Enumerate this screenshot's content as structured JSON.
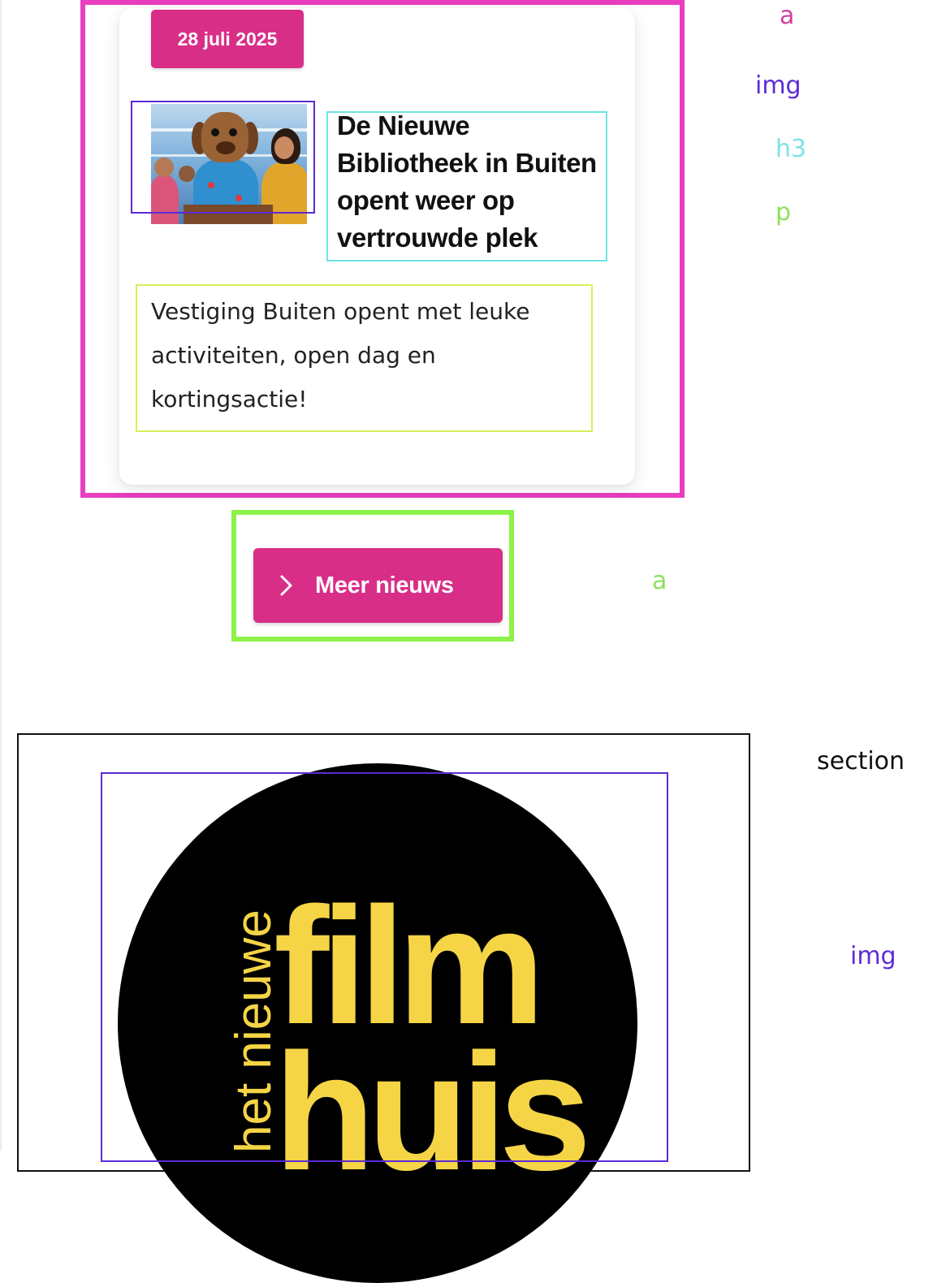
{
  "news_card": {
    "date": "28 juli 2025",
    "title": "De Nieuwe Bibliotheek in Buiten opent weer op vertrouwde plek",
    "summary": "Vestiging Buiten opent met leuke activiteiten, open dag en kortingsactie!"
  },
  "more_button": {
    "label": "Meer nieuws",
    "icon": "chevron-right-icon"
  },
  "logo": {
    "line1": "het nieuwe",
    "line2": "film",
    "line3": "huis",
    "colors": {
      "circle": "#000000",
      "text": "#f5d546"
    }
  },
  "annotation_labels": {
    "a_card": "a",
    "img_thumb": "img",
    "h3": "h3",
    "p": "p",
    "a_more": "a",
    "section": "section",
    "img_logo": "img"
  },
  "colors": {
    "brand_pink": "#d82e88",
    "outline_a": "#e83ebf",
    "outline_img": "#5b2bd6",
    "outline_h3": "#6fe3e3",
    "outline_p": "#d7f05b",
    "outline_a_more": "#8ef24a"
  }
}
